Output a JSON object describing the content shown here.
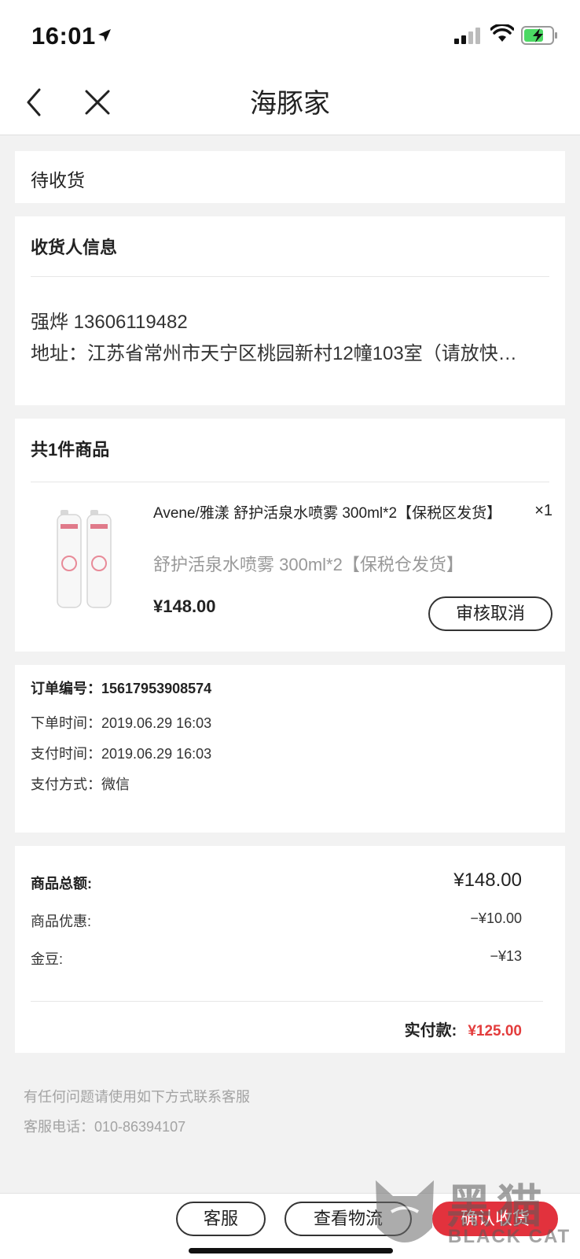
{
  "status_bar": {
    "time": "16:01",
    "icons": [
      "location-arrow-icon",
      "signal-icon",
      "wifi-icon",
      "battery-charging-icon"
    ],
    "battery_color": "#4cd964"
  },
  "nav": {
    "title": "海豚家",
    "back_icon": "chevron-left-icon",
    "close_icon": "close-icon"
  },
  "order_status": "待收货",
  "recipient": {
    "heading": "收货人信息",
    "name_phone": "强烨 13606119482",
    "address": "地址：江苏省常州市天宁区桃园新村12幢103室（请放快…"
  },
  "goods": {
    "heading": "共1件商品",
    "product_image": "avene-spray-product-image",
    "title": "Avene/雅漾 舒护活泉水喷雾 300ml*2【保税区发货】",
    "spec": "舒护活泉水喷雾 300ml*2【保税仓发货】",
    "quantity": "×1",
    "price": "¥148.00",
    "review_button": "审核取消"
  },
  "order_info": {
    "number_label": "订单编号：",
    "number": "15617953908574",
    "order_time_label": "下单时间：",
    "order_time": "2019.06.29 16:03",
    "pay_time_label": "支付时间：",
    "pay_time": "2019.06.29 16:03",
    "pay_method_label": "支付方式：",
    "pay_method": "微信"
  },
  "summary": {
    "total_label": "商品总额:",
    "total": "¥148.00",
    "discount_label": "商品优惠:",
    "discount": "−¥10.00",
    "beans_label": "金豆:",
    "beans": "−¥13",
    "paid_label": "实付款:",
    "paid": "¥125.00",
    "paid_color": "#e33c3c"
  },
  "help": {
    "line1": "有任何问题请使用如下方式联系客服",
    "line2": "客服电话：010-86394107"
  },
  "bottom_bar": {
    "service": "客服",
    "logistics": "查看物流",
    "confirm": "确认收货",
    "confirm_color": "#e2323d"
  },
  "watermark": {
    "main": "黑猫",
    "sub": "BLACK CAT"
  }
}
